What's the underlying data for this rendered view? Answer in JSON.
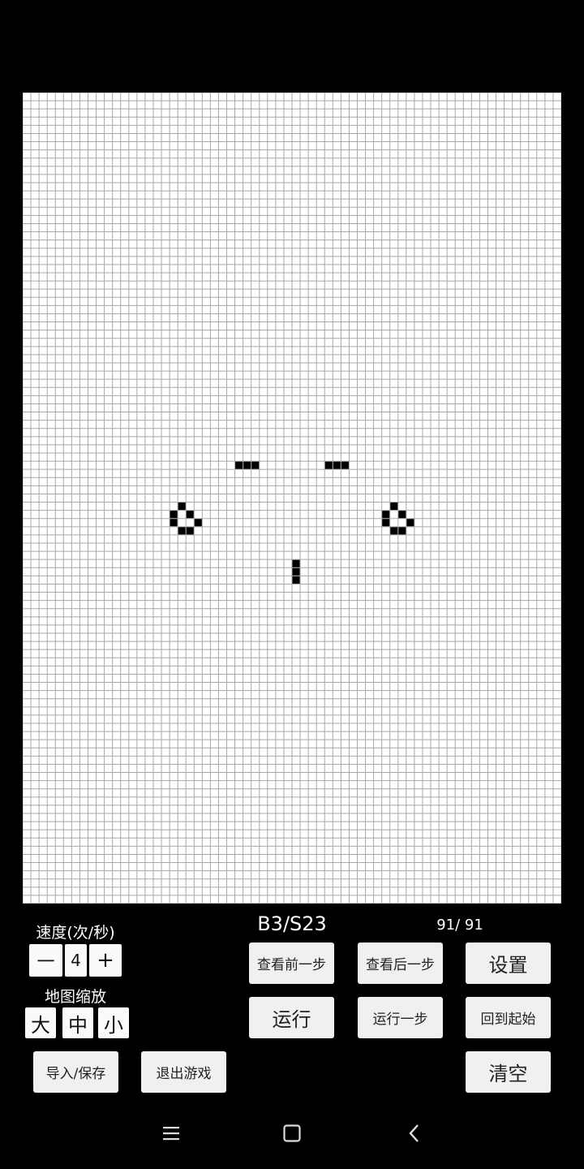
{
  "grid": {
    "cols": 66,
    "rows": 99,
    "live_cells": [
      [
        26,
        45
      ],
      [
        27,
        45
      ],
      [
        28,
        45
      ],
      [
        37,
        45
      ],
      [
        38,
        45
      ],
      [
        39,
        45
      ],
      [
        19,
        50
      ],
      [
        18,
        51
      ],
      [
        20,
        51
      ],
      [
        18,
        52
      ],
      [
        21,
        52
      ],
      [
        19,
        53
      ],
      [
        20,
        53
      ],
      [
        45,
        50
      ],
      [
        44,
        51
      ],
      [
        46,
        51
      ],
      [
        44,
        52
      ],
      [
        47,
        52
      ],
      [
        45,
        53
      ],
      [
        46,
        53
      ],
      [
        33,
        57
      ],
      [
        33,
        58
      ],
      [
        33,
        59
      ]
    ],
    "cell_color": "#000000",
    "line_color": "#a8a8a8",
    "background": "#ffffff"
  },
  "speed": {
    "label": "速度(次/秒)",
    "minus": "一",
    "value": "4",
    "plus": "+"
  },
  "zoom": {
    "label": "地图缩放",
    "large": "大",
    "medium": "中",
    "small": "小"
  },
  "rule": "B3/S23",
  "generation": "91/ 91",
  "buttons": {
    "prev_step": "查看前一步",
    "next_step": "查看后一步",
    "settings": "设置",
    "run": "运行",
    "run_one_step": "运行一步",
    "back_to_start": "回到起始",
    "import_save": "导入/保存",
    "exit_game": "退出游戏",
    "clear": "清空"
  },
  "nav": {
    "menu_icon": "menu-icon",
    "home_icon": "home-square-icon",
    "back_icon": "back-chevron-icon"
  }
}
